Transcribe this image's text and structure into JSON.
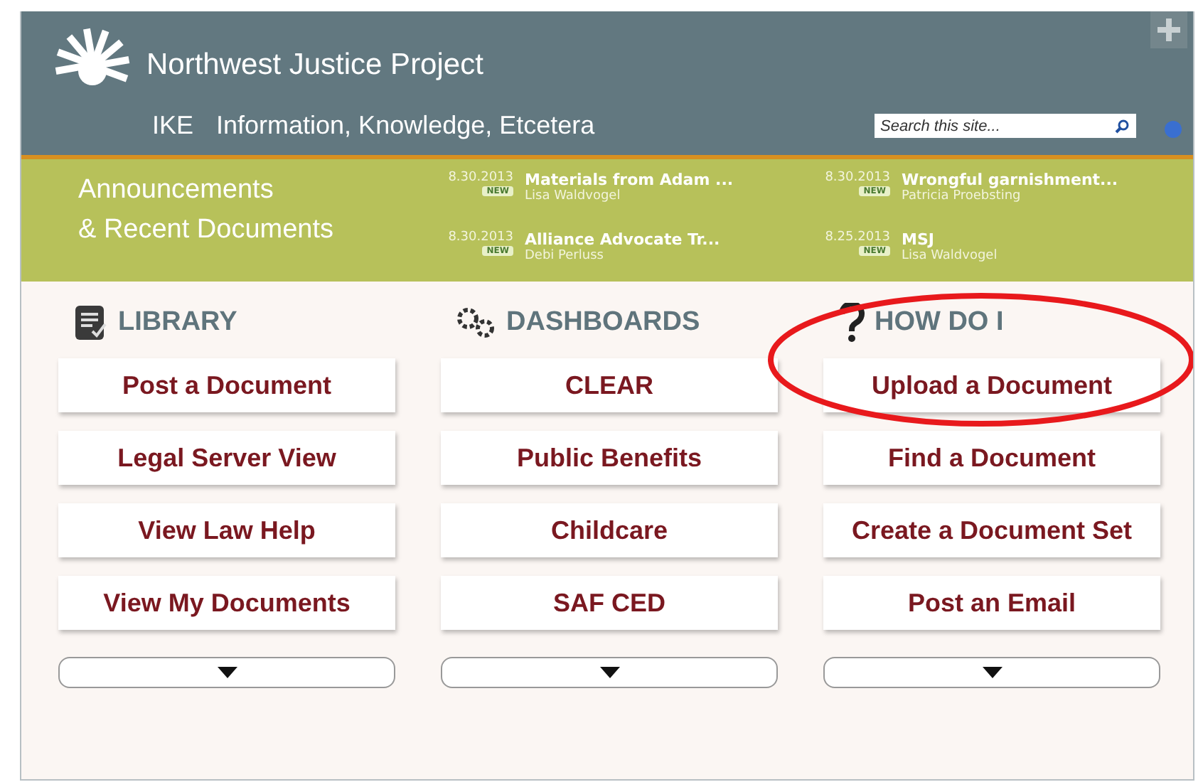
{
  "header": {
    "brand": "Northwest Justice Project",
    "site_code": "IKE",
    "site_name": "Information, Knowledge, Etcetera",
    "search": {
      "placeholder": "Search this site..."
    }
  },
  "announcements": {
    "title_lines": [
      "Announcements",
      "& Recent Documents"
    ],
    "items": [
      {
        "date": "8.30.2013",
        "badge": "NEW",
        "title": "Materials from Adam ...",
        "author": "Lisa Waldvogel"
      },
      {
        "date": "8.30.2013",
        "badge": "NEW",
        "title": "Wrongful garnishment...",
        "author": "Patricia Proebsting"
      },
      {
        "date": "8.30.2013",
        "badge": "NEW",
        "title": "Alliance Advocate Tr...",
        "author": "Debi Perluss"
      },
      {
        "date": "8.25.2013",
        "badge": "NEW",
        "title": "MSJ",
        "author": "Lisa Waldvogel"
      }
    ]
  },
  "columns": [
    {
      "kind": "library",
      "title": "LIBRARY",
      "links": [
        "Post a Document",
        "Legal Server View",
        "View Law Help",
        "View My Documents"
      ]
    },
    {
      "kind": "dashboards",
      "title": "DASHBOARDS",
      "links": [
        "CLEAR",
        "Public Benefits",
        "Childcare",
        "SAF CED"
      ]
    },
    {
      "kind": "howto",
      "title": "HOW DO I",
      "links": [
        "Upload a Document",
        "Find a Document",
        "Create a Document Set",
        "Post an Email"
      ]
    }
  ],
  "annotation": {
    "kind": "ellipse",
    "color": "#e8191c"
  }
}
